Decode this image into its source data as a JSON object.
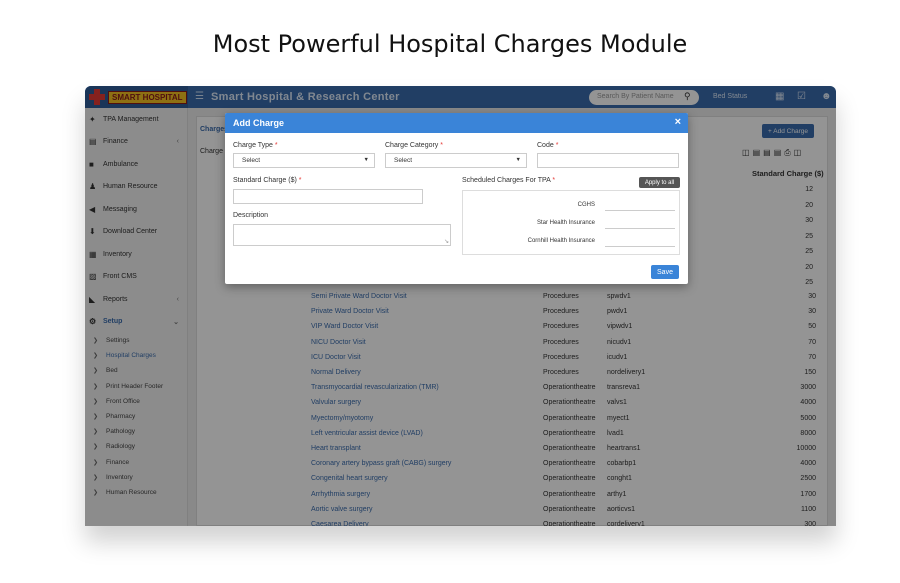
{
  "hero_title": "Most Powerful Hospital Charges Module",
  "app": {
    "logo_text": "SMART HOSPITAL",
    "title": "Smart Hospital & Research Center",
    "search_placeholder": "Search By Patient Name",
    "bed_status": "Bed Status"
  },
  "sidebar": {
    "items": [
      {
        "icon": "tpa-icon",
        "glyph": "✦",
        "label": "TPA Management",
        "caret": ""
      },
      {
        "icon": "finance-icon",
        "glyph": "▤",
        "label": "Finance",
        "caret": "‹"
      },
      {
        "icon": "ambulance-icon",
        "glyph": "■",
        "label": "Ambulance",
        "caret": ""
      },
      {
        "icon": "human-resource-icon",
        "glyph": "♟",
        "label": "Human Resource",
        "caret": ""
      },
      {
        "icon": "messaging-icon",
        "glyph": "◀",
        "label": "Messaging",
        "caret": ""
      },
      {
        "icon": "download-icon",
        "glyph": "⬇",
        "label": "Download Center",
        "caret": ""
      },
      {
        "icon": "inventory-icon",
        "glyph": "▦",
        "label": "Inventory",
        "caret": ""
      },
      {
        "icon": "front-cms-icon",
        "glyph": "▨",
        "label": "Front CMS",
        "caret": ""
      },
      {
        "icon": "reports-icon",
        "glyph": "◣",
        "label": "Reports",
        "caret": "‹"
      },
      {
        "icon": "setup-icon",
        "glyph": "⚙",
        "label": "Setup",
        "caret": "⌄"
      }
    ],
    "sub_items": [
      "Settings",
      "Hospital Charges",
      "Bed",
      "Print Header Footer",
      "Front Office",
      "Pharmacy",
      "Pathology",
      "Radiology",
      "Finance",
      "Inventory",
      "Human Resource"
    ]
  },
  "page": {
    "tab_charges": "Charges",
    "tab_charge2": "Charge",
    "add_charge_button": "+ Add Charge",
    "std_charge_header": "Standard Charge ($)",
    "partial_values": [
      "12",
      "20",
      "30",
      "25",
      "25",
      "20",
      "25"
    ],
    "rows": [
      [
        "Semi Private Ward Doctor Visit",
        "Procedures",
        "spwdv1",
        "30"
      ],
      [
        "Private Ward Doctor Visit",
        "Procedures",
        "pwdv1",
        "30"
      ],
      [
        "VIP Ward Doctor Visit",
        "Procedures",
        "vipwdv1",
        "50"
      ],
      [
        "NICU Doctor Visit",
        "Procedures",
        "nicudv1",
        "70"
      ],
      [
        "ICU Doctor Visit",
        "Procedures",
        "icudv1",
        "70"
      ],
      [
        "Normal Delivery",
        "Procedures",
        "nordelivery1",
        "150"
      ],
      [
        "Transmyocardial revascularization (TMR)",
        "Operationtheatre",
        "transreva1",
        "3000"
      ],
      [
        "Valvular surgery",
        "Operationtheatre",
        "valvs1",
        "4000"
      ],
      [
        "Myectomy/myotomy",
        "Operationtheatre",
        "myect1",
        "5000"
      ],
      [
        "Left ventricular assist device (LVAD)",
        "Operationtheatre",
        "lvad1",
        "8000"
      ],
      [
        "Heart transplant",
        "Operationtheatre",
        "heartrans1",
        "10000"
      ],
      [
        "Coronary artery bypass graft (CABG) surgery",
        "Operationtheatre",
        "cobarbp1",
        "4000"
      ],
      [
        "Congenital heart surgery",
        "Operationtheatre",
        "conght1",
        "2500"
      ],
      [
        "Arrhythmia surgery",
        "Operationtheatre",
        "arthy1",
        "1700"
      ],
      [
        "Aortic valve surgery",
        "Operationtheatre",
        "aorticvs1",
        "1100"
      ],
      [
        "Caesarea Delivery",
        "Operationtheatre",
        "cordelivery1",
        "300"
      ]
    ]
  },
  "modal": {
    "title": "Add Charge",
    "close": "×",
    "charge_type_label": "Charge Type",
    "charge_type_value": "Select",
    "charge_category_label": "Charge Category",
    "charge_category_value": "Select",
    "code_label": "Code",
    "standard_charge_label": "Standard Charge ($)",
    "scheduled_label": "Scheduled Charges For TPA",
    "apply_all": "Apply to all",
    "description_label": "Description",
    "tpa": [
      "CGHS",
      "Star Health Insurance",
      "Cornhill Health Insurance"
    ],
    "save": "Save",
    "required_mark": "*"
  }
}
